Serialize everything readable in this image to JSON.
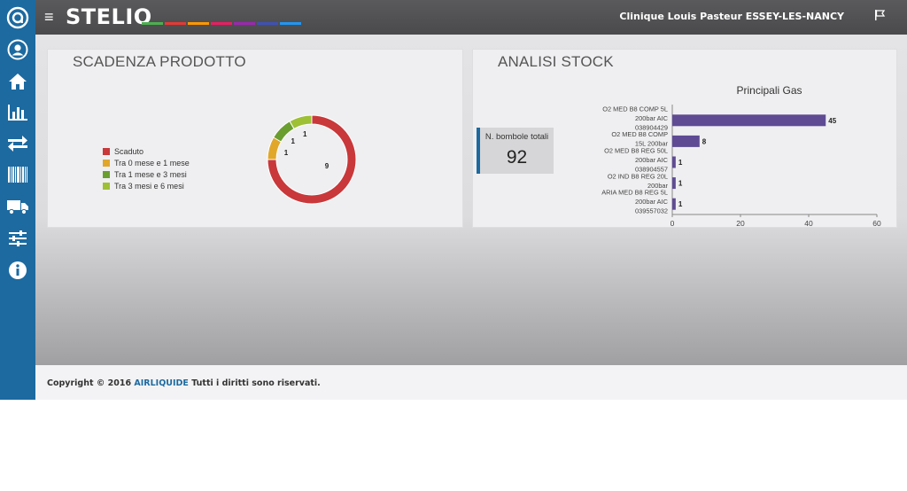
{
  "brand": {
    "name": "STELIO",
    "stripe_colors": [
      "#4caf50",
      "#e53935",
      "#ff9800",
      "#e91e63",
      "#9c27b0",
      "#3f51b5",
      "#2196f3"
    ]
  },
  "header": {
    "clinic": "Clinique Louis Pasteur ESSEY-LES-NANCY",
    "menu_icon": "hamburger-icon",
    "flag_icon": "flag-icon"
  },
  "sidebar": {
    "items": [
      {
        "name": "user",
        "icon": "user-icon"
      },
      {
        "name": "home",
        "icon": "home-icon"
      },
      {
        "name": "charts",
        "icon": "bar-chart-icon"
      },
      {
        "name": "transfers",
        "icon": "transfer-arrows-icon"
      },
      {
        "name": "barcode",
        "icon": "barcode-icon"
      },
      {
        "name": "delivery",
        "icon": "truck-icon"
      },
      {
        "name": "settings",
        "icon": "sliders-icon"
      },
      {
        "name": "info",
        "icon": "info-icon"
      }
    ]
  },
  "expiry": {
    "title": "SCADENZA PRODOTTO",
    "legend": [
      {
        "label": "Scaduto",
        "color": "#c9383a"
      },
      {
        "label": "Tra 0 mese e 1 mese",
        "color": "#e1a72a"
      },
      {
        "label": "Tra 1 mese e 3 mesi",
        "color": "#6a9e2f"
      },
      {
        "label": "Tra 3 mesi e 6 mesi",
        "color": "#9dc035"
      }
    ]
  },
  "stock": {
    "title": "ANALISI STOCK",
    "total_label": "N. bombole totali",
    "total_value": "92"
  },
  "chart_data": [
    {
      "type": "pie",
      "categories": [
        "Scaduto",
        "Tra 0 mese e 1 mese",
        "Tra 1 mese e 3 mesi",
        "Tra 3 mesi e 6 mesi"
      ],
      "values": [
        9,
        1,
        1,
        1
      ],
      "colors": [
        "#c9383a",
        "#e1a72a",
        "#6a9e2f",
        "#9dc035"
      ],
      "data_labels": [
        "9",
        "1",
        "1",
        "1"
      ],
      "donut": true
    },
    {
      "type": "bar",
      "orientation": "horizontal",
      "title": "Principali Gas",
      "categories": [
        [
          "O2 MED B8 COMP 5L",
          "200bar AIC",
          "038904429"
        ],
        [
          "O2 MED B8 COMP",
          "15L 200bar"
        ],
        [
          "O2 MED B8 REG 50L",
          "200bar AIC",
          "038904557"
        ],
        [
          "O2 IND B8 REG 20L",
          "200bar"
        ],
        [
          "ARIA MED B8 REG 5L",
          "200bar AIC",
          "039557032"
        ]
      ],
      "values": [
        45,
        8,
        1,
        1,
        1
      ],
      "xlim": [
        0,
        60
      ],
      "xticks": [
        0,
        20,
        40,
        60
      ],
      "color": "#5e4b94"
    }
  ],
  "footer": {
    "prefix": "Copyright © 2016 ",
    "link": "AIRLIQUIDE",
    "suffix": " Tutti i diritti sono riservati."
  }
}
